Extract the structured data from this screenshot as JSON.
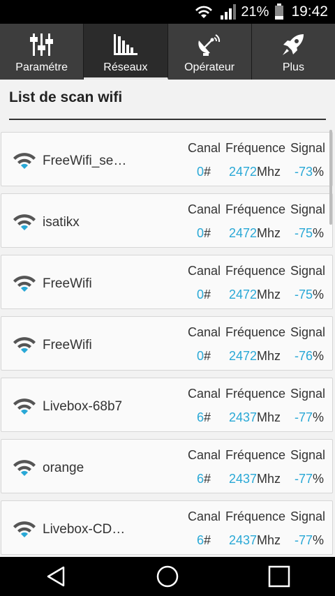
{
  "status_bar": {
    "battery_percent": "21%",
    "time": "19:42",
    "icons": [
      "wifi-icon",
      "signal-icon",
      "battery-icon"
    ]
  },
  "tabs": [
    {
      "label": "Paramétre",
      "icon": "sliders-icon",
      "active": false
    },
    {
      "label": "Réseaux",
      "icon": "bar-chart-icon",
      "active": true
    },
    {
      "label": "Opérateur",
      "icon": "satellite-dish-icon",
      "active": false
    },
    {
      "label": "Plus",
      "icon": "rocket-icon",
      "active": false
    }
  ],
  "section_title": "List de scan wifi",
  "column_headers": {
    "canal": "Canal",
    "frequence": "Fréquence",
    "signal": "Signal"
  },
  "units": {
    "canal": "#",
    "frequence": "Mhz",
    "signal": "%"
  },
  "networks": [
    {
      "ssid": "FreeWifi_se…",
      "canal": "0",
      "frequence": "2472",
      "signal": "-73"
    },
    {
      "ssid": "isatikx",
      "canal": "0",
      "frequence": "2472",
      "signal": "-75"
    },
    {
      "ssid": "FreeWifi",
      "canal": "0",
      "frequence": "2472",
      "signal": "-75"
    },
    {
      "ssid": "FreeWifi",
      "canal": "0",
      "frequence": "2472",
      "signal": "-76"
    },
    {
      "ssid": "Livebox-68b7",
      "canal": "6",
      "frequence": "2437",
      "signal": "-77"
    },
    {
      "ssid": "orange",
      "canal": "6",
      "frequence": "2437",
      "signal": "-77"
    },
    {
      "ssid": "Livebox-CD…",
      "canal": "6",
      "frequence": "2437",
      "signal": "-77"
    }
  ],
  "colors": {
    "accent": "#29a8d6",
    "tab_bar": "#363636",
    "status_bar": "#000000"
  },
  "nav_icons": [
    "back-icon",
    "home-icon",
    "recents-icon"
  ]
}
